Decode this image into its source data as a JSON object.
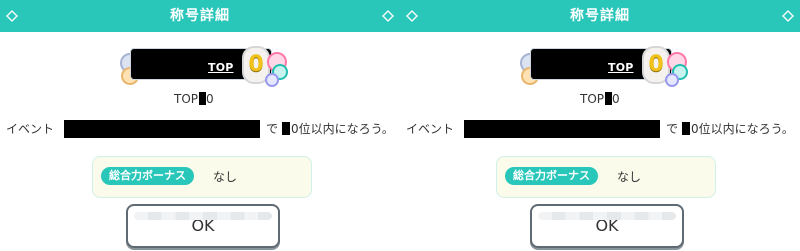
{
  "panels": [
    {
      "header": {
        "title": "称号詳細"
      },
      "badge": {
        "top_label": "TOP",
        "rank_digit": "0"
      },
      "title_line": {
        "prefix": "TOP",
        "suffix": "0"
      },
      "description": {
        "part1": "イベント",
        "part2": "で",
        "part3": "0位以内になろう。"
      },
      "bonus": {
        "label": "総合力ボーナス",
        "value": "なし"
      },
      "ok": {
        "label": "OK"
      }
    },
    {
      "header": {
        "title": "称号詳細"
      },
      "badge": {
        "top_label": "TOP",
        "rank_digit": "0"
      },
      "title_line": {
        "prefix": "TOP",
        "suffix": "0"
      },
      "description": {
        "part1": "イベント",
        "part2": "で",
        "part3": "0位以内になろう。"
      },
      "bonus": {
        "label": "総合力ボーナス",
        "value": "なし"
      },
      "ok": {
        "label": "OK"
      }
    }
  ]
}
